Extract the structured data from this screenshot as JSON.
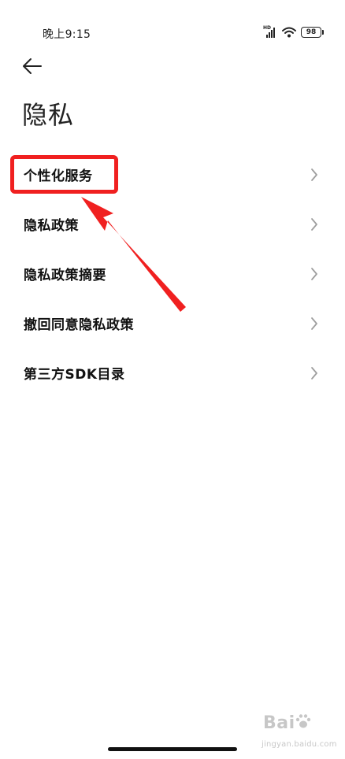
{
  "status_bar": {
    "time": "晚上9:15",
    "network_label": "HD",
    "battery": "98",
    "icons": [
      "hd-signal-icon",
      "wifi-icon",
      "battery-icon"
    ]
  },
  "header": {
    "back_icon": "back-arrow-icon",
    "title": "隐私"
  },
  "menu": {
    "items": [
      {
        "label": "个性化服务"
      },
      {
        "label": "隐私政策"
      },
      {
        "label": "隐私政策摘要"
      },
      {
        "label": "撤回同意隐私政策"
      },
      {
        "label": "第三方SDK目录"
      }
    ],
    "chevron_icon": "chevron-right-icon"
  },
  "annotation": {
    "highlight_color": "#f02020",
    "highlighted_item": "个性化服务"
  },
  "watermark": {
    "brand": "Bai",
    "url": "jingyan.baidu.com"
  },
  "colors": {
    "text_primary": "#111111",
    "chevron": "#9e9e9e",
    "annotation": "#f02020"
  }
}
